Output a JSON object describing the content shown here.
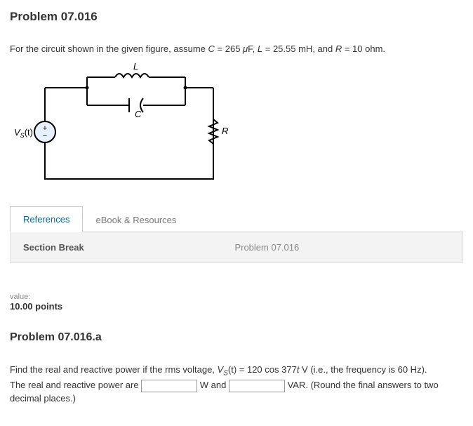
{
  "problem": {
    "title": "Problem 07.016",
    "intro_prefix": "For the circuit shown in the given figure, assume ",
    "params": {
      "C_var": "C",
      "C_eq": " = 265 ",
      "C_unit_prefix": "μ",
      "C_unit": "F, ",
      "L_var": "L",
      "L_eq": " = 25.55 mH, and ",
      "R_var": "R",
      "R_eq": " = 10 ohm."
    }
  },
  "circuit": {
    "labels": {
      "L": "L",
      "C": "C",
      "R": "R",
      "Vs": "V",
      "Vs_sub": "S",
      "Vs_arg": "(t)"
    }
  },
  "tabs": {
    "references": "References",
    "ebook": "eBook & Resources"
  },
  "section_break": {
    "label": "Section Break",
    "center": "Problem 07.016"
  },
  "value": {
    "label": "value:",
    "points": "10.00 points"
  },
  "subproblem": {
    "title": "Problem 07.016.a",
    "line1_prefix": "Find the real and reactive power if the rms voltage, ",
    "vs_var": "V",
    "vs_sub": "S",
    "vs_expr": "(t) = 120 cos 377",
    "t_var": "t",
    "line1_suffix": " V (i.e., the frequency is 60 Hz).",
    "line2_prefix": "The real and reactive power are ",
    "w_label": " W and ",
    "var_label": " VAR. (Round the final answers to two decimal places.)"
  }
}
